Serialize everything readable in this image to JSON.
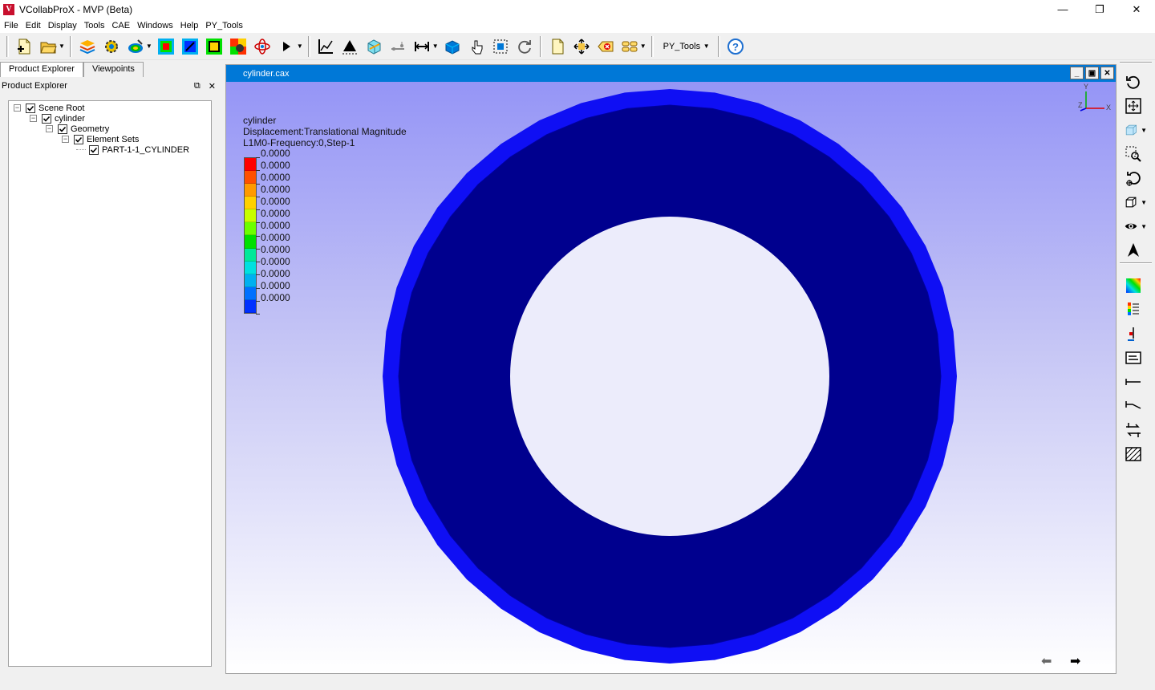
{
  "window": {
    "title": "VCollabProX - MVP (Beta)",
    "logo_letter": "V",
    "minimize": "—",
    "maximize": "❐",
    "close": "✕"
  },
  "menu": [
    "File",
    "Edit",
    "Display",
    "Tools",
    "CAE",
    "Windows",
    "Help",
    "PY_Tools"
  ],
  "toolbar": {
    "py_tools_select": "PY_Tools",
    "icons": [
      "new-file-icon",
      "open-folder-icon",
      "layers-icon",
      "settings-gear-icon",
      "contour-icon",
      "fringe-plot-icon",
      "iso-surface-icon",
      "feature-edge-icon",
      "animation-settings-icon",
      "atom-icon",
      "play-icon",
      "xy-plot-icon",
      "probe-icon",
      "section-cube-icon",
      "measure-icon",
      "dimension-icon",
      "transform-icon",
      "pick-icon",
      "select-box-icon",
      "refresh-icon",
      "document-icon",
      "move-icon",
      "delete-icon",
      "group-icon",
      "help-icon"
    ]
  },
  "left_panel": {
    "tabs": [
      "Product Explorer",
      "Viewpoints"
    ],
    "active_tab": "Product Explorer",
    "header": "Product Explorer",
    "float_button": "⧉",
    "close_button": "✕",
    "tree": [
      {
        "label": "Scene Root",
        "level": 0,
        "expander": "−",
        "checked": true
      },
      {
        "label": "cylinder",
        "level": 1,
        "expander": "−",
        "checked": true
      },
      {
        "label": "Geometry",
        "level": 2,
        "expander": "−",
        "checked": true
      },
      {
        "label": "Element Sets",
        "level": 3,
        "expander": "−",
        "checked": true
      },
      {
        "label": "PART-1-1_CYLINDER",
        "level": 4,
        "expander": "",
        "checked": true
      }
    ]
  },
  "viewport": {
    "title": "cylinder.cax",
    "legend": {
      "model": "cylinder",
      "result": "Displacement:Translational Magnitude",
      "step": "L1M0-Frequency:0,Step-1",
      "values": [
        "0.0000",
        "0.0000",
        "0.0000",
        "0.0000",
        "0.0000",
        "0.0000",
        "0.0000",
        "0.0000",
        "0.0000",
        "0.0000",
        "0.0000",
        "0.0000",
        "0.0000"
      ],
      "colors": [
        "#ff0000",
        "#ff5000",
        "#ff9a00",
        "#ffd000",
        "#c8ff00",
        "#6cff00",
        "#00e000",
        "#00e89a",
        "#00e0e0",
        "#00b0f0",
        "#0070ff",
        "#0030ff"
      ]
    },
    "axes": {
      "x": "X",
      "y": "Y",
      "z": "Z"
    },
    "nav_prev": "⬅",
    "nav_next": "➡",
    "model_colors": {
      "outer_ring": "#0f0ff4",
      "body": "#00008e",
      "body_edge": "#0000a0"
    }
  },
  "right_toolbar": {
    "icons": [
      "rotate-icon",
      "fit-view-icon",
      "view-cube-icon",
      "zoom-region-icon",
      "pivot-rotate-icon",
      "box-view-icon",
      "visibility-eye-icon",
      "navigate-arrow-icon",
      "color-legend-icon",
      "legend-settings-icon",
      "probe-label-icon",
      "text-annotation-icon",
      "distance-icon",
      "angle-icon",
      "transform-arrows-icon",
      "hatch-icon"
    ]
  }
}
